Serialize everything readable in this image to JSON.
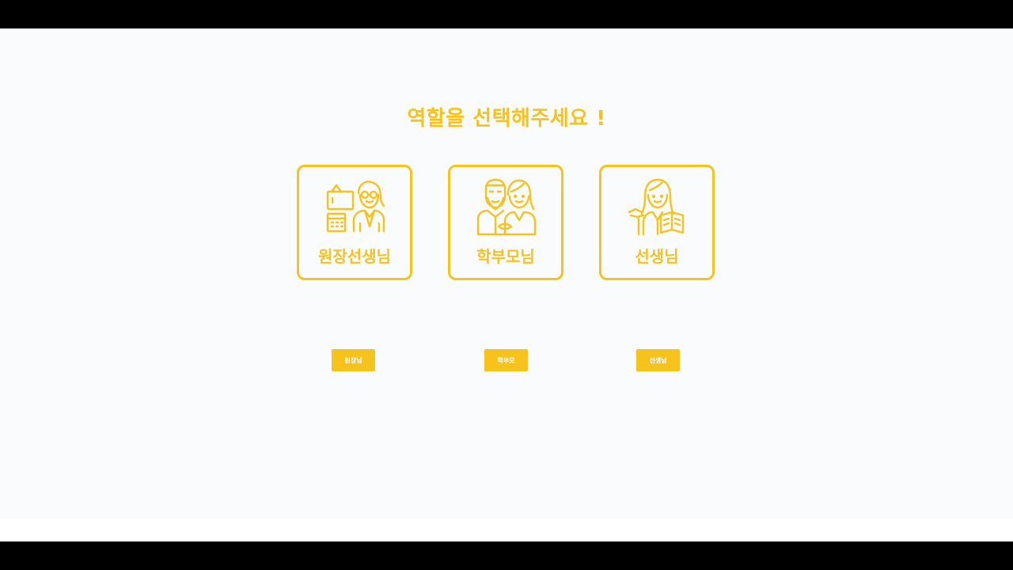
{
  "page": {
    "title": "역할을 선택해주세요 !"
  },
  "cards": [
    {
      "label": "원장선생님",
      "icon": "director-icon"
    },
    {
      "label": "학부모님",
      "icon": "parents-icon"
    },
    {
      "label": "선생님",
      "icon": "teacher-icon"
    }
  ],
  "buttons": [
    {
      "label": "원장님"
    },
    {
      "label": "학부모"
    },
    {
      "label": "선생님"
    }
  ],
  "colors": {
    "accent": "#f6c21c",
    "background": "#fafbfd",
    "button_text": "#ffffff"
  }
}
